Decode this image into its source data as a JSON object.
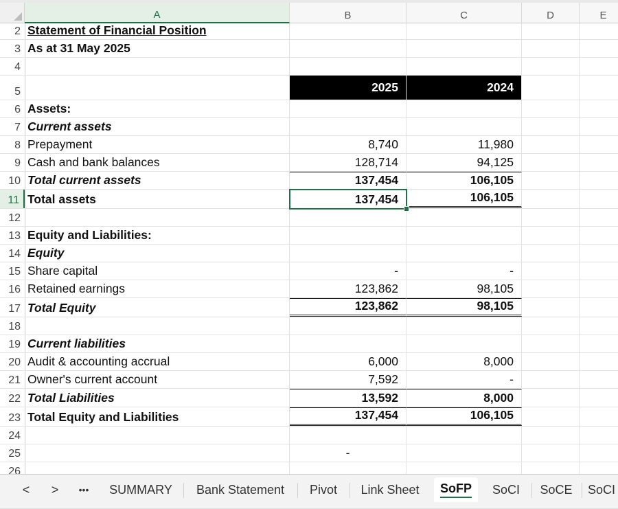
{
  "columns": [
    "A",
    "B",
    "C",
    "D",
    "E"
  ],
  "active_column": "A",
  "rows": [
    {
      "n": "2",
      "a": "Statement of Financial Position",
      "b": "",
      "c": ""
    },
    {
      "n": "3",
      "a": "As at 31 May 2025",
      "b": "",
      "c": ""
    },
    {
      "n": "4",
      "a": "",
      "b": "",
      "c": ""
    },
    {
      "n": "5",
      "a": "",
      "b": "2025",
      "c": "2024"
    },
    {
      "n": "6",
      "a": "Assets:",
      "b": "",
      "c": ""
    },
    {
      "n": "7",
      "a": "Current assets",
      "b": "",
      "c": ""
    },
    {
      "n": "8",
      "a": "Prepayment",
      "b": "8,740",
      "c": "11,980"
    },
    {
      "n": "9",
      "a": "Cash and bank balances",
      "b": "128,714",
      "c": "94,125"
    },
    {
      "n": "10",
      "a": "Total current assets",
      "b": "137,454",
      "c": "106,105"
    },
    {
      "n": "11",
      "a": "Total assets",
      "b": "137,454",
      "c": "106,105"
    },
    {
      "n": "12",
      "a": "",
      "b": "",
      "c": ""
    },
    {
      "n": "13",
      "a": "Equity and Liabilities:",
      "b": "",
      "c": ""
    },
    {
      "n": "14",
      "a": "Equity",
      "b": "",
      "c": ""
    },
    {
      "n": "15",
      "a": "Share capital",
      "b": "-",
      "c": "-"
    },
    {
      "n": "16",
      "a": "Retained earnings",
      "b": "123,862",
      "c": "98,105"
    },
    {
      "n": "17",
      "a": "Total Equity",
      "b": "123,862",
      "c": "98,105"
    },
    {
      "n": "18",
      "a": "",
      "b": "",
      "c": ""
    },
    {
      "n": "19",
      "a": "Current liabilities",
      "b": "",
      "c": ""
    },
    {
      "n": "20",
      "a": "Audit & accounting accrual",
      "b": "6,000",
      "c": "8,000"
    },
    {
      "n": "21",
      "a": "Owner's current account",
      "b": "7,592",
      "c": "-"
    },
    {
      "n": "22",
      "a": "Total Liabilities",
      "b": "13,592",
      "c": "8,000"
    },
    {
      "n": "23",
      "a": "Total Equity and Liabilities",
      "b": "137,454",
      "c": "106,105"
    },
    {
      "n": "24",
      "a": "",
      "b": "",
      "c": ""
    },
    {
      "n": "25",
      "a": "",
      "b": "-",
      "c": ""
    },
    {
      "n": "26",
      "a": "",
      "b": "",
      "c": ""
    }
  ],
  "tabs": {
    "prev": "<",
    "next": ">",
    "more": "•••",
    "sheets": [
      "SUMMARY",
      "Bank Statement",
      "Pivot",
      "Link Sheet",
      "SoFP",
      "SoCI",
      "SoCE",
      "SoCI"
    ],
    "active_sheet": "SoFP"
  },
  "colors": {
    "accent": "#1e7145",
    "header_black": "#000000"
  }
}
